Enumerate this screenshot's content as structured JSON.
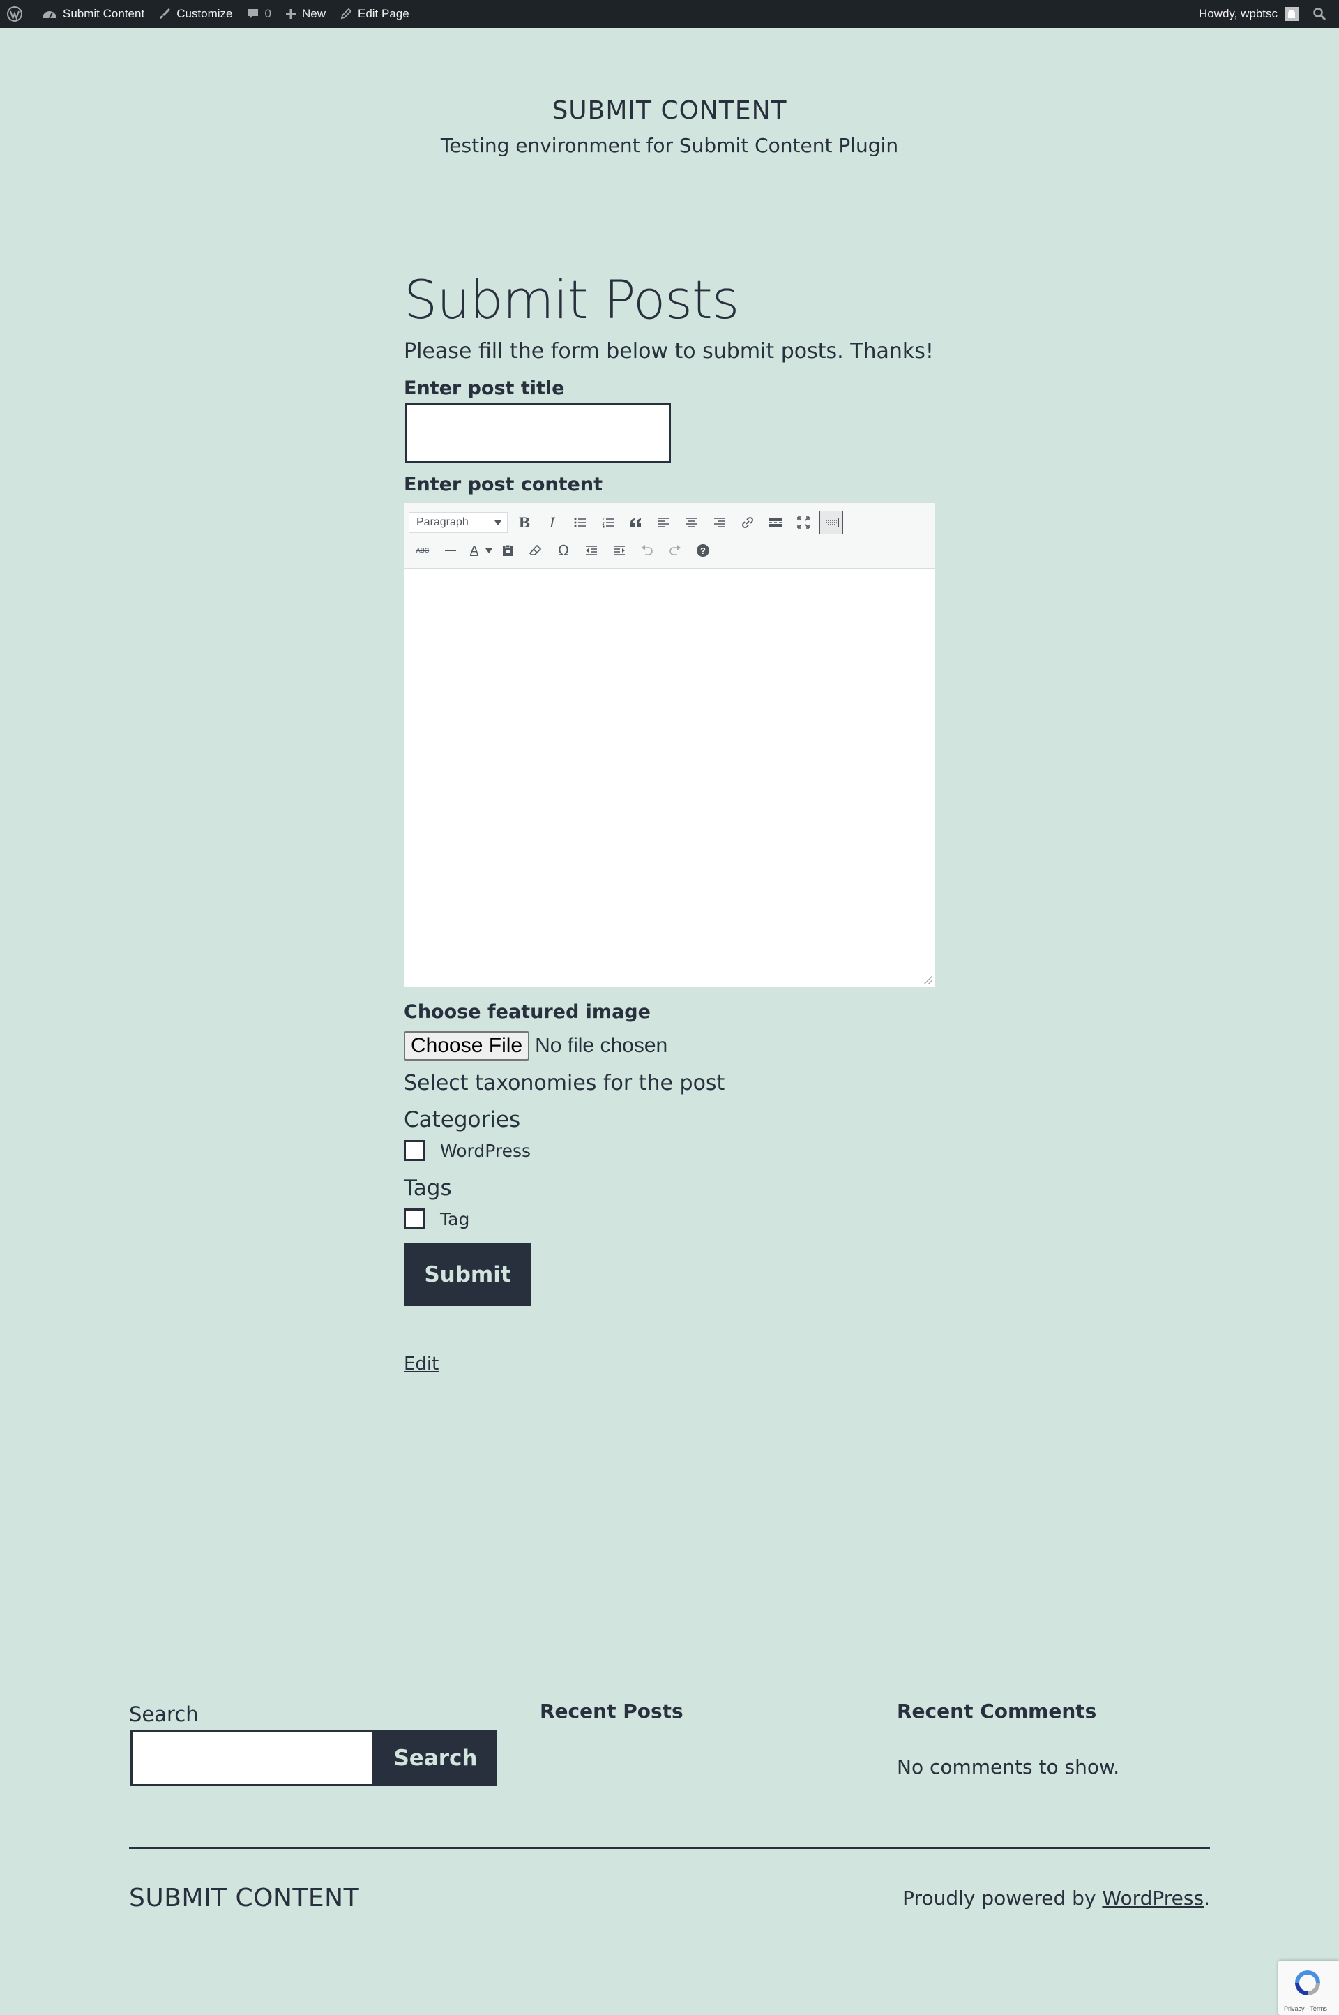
{
  "adminbar": {
    "site_name": "Submit Content",
    "customize": "Customize",
    "comments_count": "0",
    "new": "New",
    "edit_page": "Edit Page",
    "howdy": "Howdy, wpbtsc"
  },
  "header": {
    "site_title": "SUBMIT CONTENT",
    "tagline": "Testing environment for Submit Content Plugin"
  },
  "main": {
    "page_title": "Submit Posts",
    "intro": "Please fill the form below to submit posts. Thanks!",
    "title_label": "Enter post title",
    "title_value": "",
    "content_label": "Enter post content",
    "editor": {
      "format_select": "Paragraph",
      "row1_icons": [
        "bold-icon",
        "italic-icon",
        "bullet-list-icon",
        "numbered-list-icon",
        "blockquote-icon",
        "align-left-icon",
        "align-center-icon",
        "align-right-icon",
        "link-icon",
        "read-more-icon",
        "fullscreen-icon",
        "toolbar-toggle-icon"
      ],
      "row2_icons": [
        "strikethrough-icon",
        "horizontal-line-icon",
        "text-color-icon",
        "paste-text-icon",
        "clear-formatting-icon",
        "special-character-icon",
        "outdent-icon",
        "indent-icon",
        "undo-icon",
        "redo-icon",
        "help-icon"
      ],
      "bold_glyph": "B",
      "italic_glyph": "I",
      "abc_glyph": "ABC",
      "omega_glyph": "Ω",
      "help_glyph": "?",
      "text_color_glyph": "A"
    },
    "image_label": "Choose featured image",
    "choose_file": "Choose File",
    "no_file": "No file chosen",
    "taxonomy_heading": "Select taxonomies for the post",
    "categories_label": "Categories",
    "category_item": "WordPress",
    "tags_label": "Tags",
    "tag_item": "Tag",
    "submit": "Submit",
    "edit": "Edit"
  },
  "footer": {
    "search_label": "Search",
    "search_button": "Search",
    "search_value": "",
    "recent_posts": "Recent Posts",
    "recent_comments": "Recent Comments",
    "no_comments": "No comments to show.",
    "site_title": "SUBMIT CONTENT",
    "powered_prefix": "Proudly powered by ",
    "powered_link": "WordPress",
    "powered_suffix": ".",
    "recaptcha_text": "Privacy - Terms"
  },
  "colors": {
    "background": "#d1e4dd",
    "text": "#28303d",
    "adminbar": "#1d2327"
  }
}
